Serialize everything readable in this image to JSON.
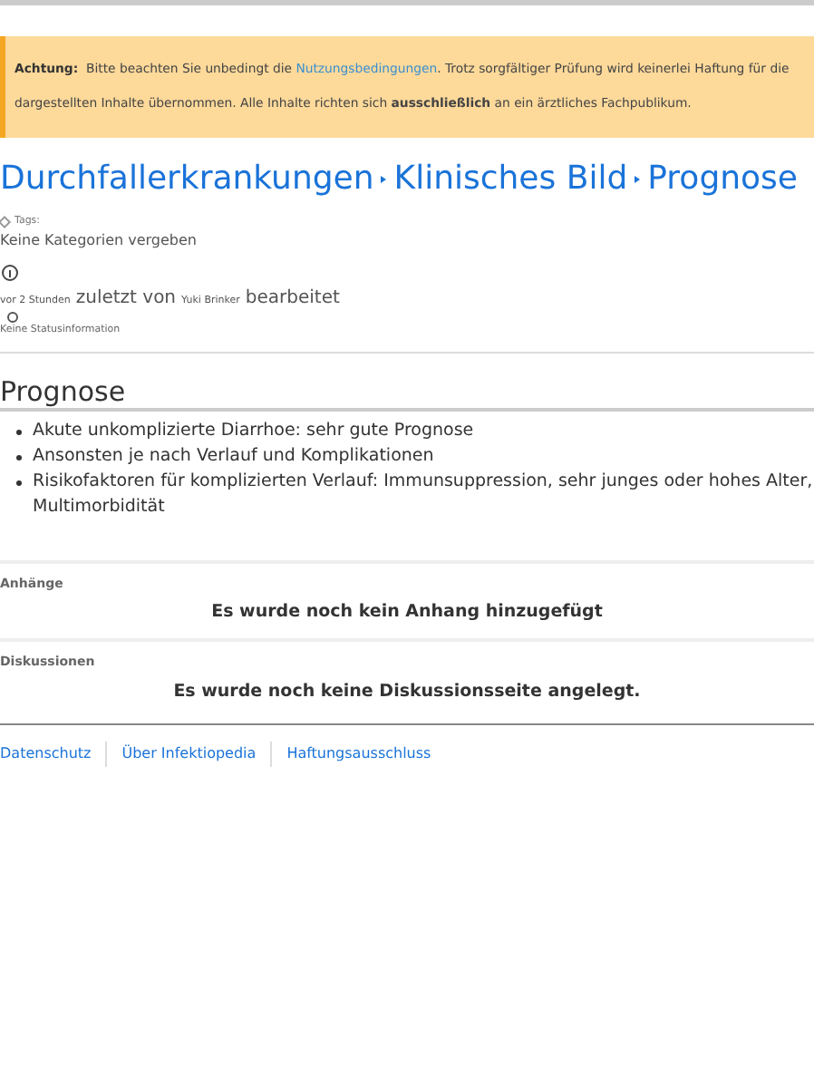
{
  "notice": {
    "label": "Achtung:",
    "before": "Bitte beachten Sie unbedingt die ",
    "link": "Nutzungsbedingungen",
    "after": ". Trotz sorgfältiger Prüfung wird keinerlei Haftung für die dargestellten Inhalte übernommen. Alle Inhalte richten sich **ausschließlich** an ein ärztliches Fachpublikum."
  },
  "breadcrumb": [
    {
      "label": "Durchfallerkrankungen"
    },
    {
      "label": "Klinisches Bild"
    },
    {
      "label": "Prognose"
    }
  ],
  "tags": {
    "label": "Tags:",
    "value": "Keine Kategorien vergeben"
  },
  "edit_info": {
    "time": "vor 2 Stunden",
    "middle": "zuletzt von",
    "user": "Yuki Brinker",
    "end": "bearbeitet"
  },
  "status": "Keine Statusinformation",
  "section": {
    "title": "Prognose",
    "items": [
      "Akute unkomplizierte Diarrhoe: sehr gute Prognose",
      "Ansonsten je nach Verlauf und Komplikationen",
      "Risikofaktoren für komplizierten Verlauf: Immunsuppression, sehr junges oder hohes Alter, Multimorbidität"
    ]
  },
  "attachments": {
    "title": "Anhänge",
    "message": "Es wurde noch kein Anhang hinzugefügt"
  },
  "discussions": {
    "title": "Diskussionen",
    "message": "Es wurde noch keine Diskussionsseite angelegt."
  },
  "footer_links": [
    "Datenschutz",
    "Über Infektiopedia",
    "Haftungsausschluss"
  ]
}
